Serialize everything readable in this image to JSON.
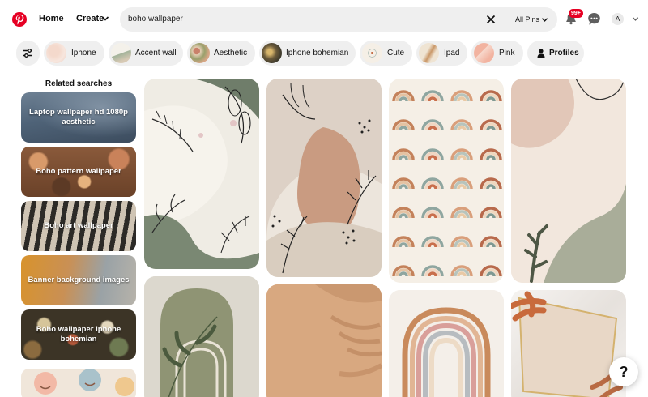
{
  "header": {
    "logo_icon": "pinterest-logo-icon",
    "home_label": "Home",
    "create_label": "Create",
    "search_value": "boho wallpaper",
    "search_scope": "All Pins",
    "notification_badge": "99+",
    "avatar_initial": "A",
    "brand_color": "#e60023"
  },
  "chips": [
    {
      "label": "Iphone"
    },
    {
      "label": "Accent wall"
    },
    {
      "label": "Aesthetic"
    },
    {
      "label": "Iphone bohemian"
    },
    {
      "label": "Cute"
    },
    {
      "label": "Ipad"
    },
    {
      "label": "Pink"
    },
    {
      "label": "Profiles"
    }
  ],
  "related": {
    "title": "Related searches",
    "items": [
      {
        "label": "Laptop wallpaper hd 1080p aesthetic"
      },
      {
        "label": "Boho pattern wallpaper"
      },
      {
        "label": "Boho art wallpaper"
      },
      {
        "label": "Banner background images"
      },
      {
        "label": "Boho wallpaper iphone bohemian"
      }
    ]
  },
  "help_label": "?"
}
